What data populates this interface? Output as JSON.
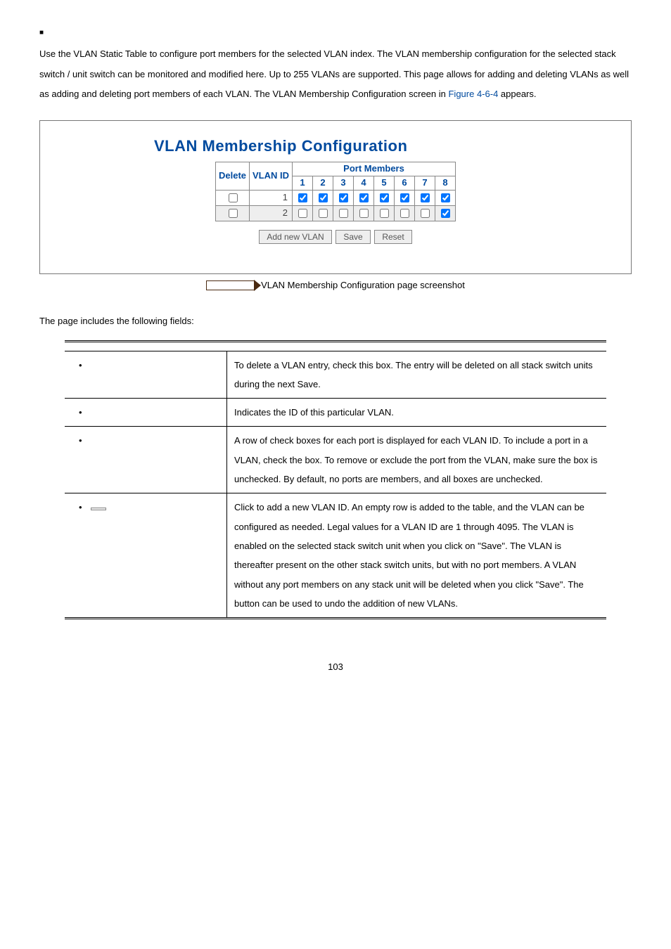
{
  "heading_marker": "■",
  "intro": {
    "text_before": "Use the VLAN Static Table to configure port members for the selected VLAN index. The VLAN membership configuration for the selected stack switch / unit switch can be monitored and modified here. Up to 255 VLANs are supported. This page allows for adding and deleting VLANs as well as adding and deleting port members of each VLAN. The VLAN Membership Configuration screen in ",
    "figref": "Figure 4-6-4",
    "text_after": " appears."
  },
  "screenshot": {
    "title": "VLAN Membership Configuration",
    "headers": {
      "delete": "Delete",
      "vlanid": "VLAN ID",
      "port_members": "Port Members"
    },
    "ports": [
      "1",
      "2",
      "3",
      "4",
      "5",
      "6",
      "7",
      "8"
    ],
    "rows": [
      {
        "delete_checked": false,
        "vlan_id": "1",
        "members": [
          true,
          true,
          true,
          true,
          true,
          true,
          true,
          true
        ]
      },
      {
        "delete_checked": false,
        "vlan_id": "2",
        "members": [
          false,
          false,
          false,
          false,
          false,
          false,
          false,
          true
        ]
      }
    ],
    "buttons": {
      "add": "Add new VLAN",
      "save": "Save",
      "reset": "Reset"
    }
  },
  "caption": "VLAN Membership Configuration page screenshot",
  "fields_intro": "The page includes the following fields:",
  "fields_table": {
    "headers": {
      "object": "",
      "description": ""
    },
    "rows": [
      {
        "object": "",
        "description": "To delete a VLAN entry, check this box.\nThe entry will be deleted on all stack switch units during the next Save."
      },
      {
        "object": "",
        "description": "Indicates the ID of this particular VLAN."
      },
      {
        "object": "",
        "description": "A row of check boxes for each port is displayed for each VLAN ID. To include a port in a VLAN, check the box. To remove or exclude the port from the VLAN, make sure the box is unchecked. By default, no ports are members, and all boxes are unchecked."
      },
      {
        "object": "",
        "description": "Click to add a new VLAN ID. An empty row is added to the table, and the VLAN can be configured as needed. Legal values for a VLAN ID are 1 through 4095.\nThe VLAN is enabled on the selected stack switch unit when you click on \"Save\".\nThe VLAN is thereafter present on the other stack switch units, but with no port members.\nA VLAN without any port members on any stack unit will be deleted when you click \"Save\".\nThe button can be used to undo the addition of new VLANs."
      }
    ]
  },
  "page_number": "103"
}
